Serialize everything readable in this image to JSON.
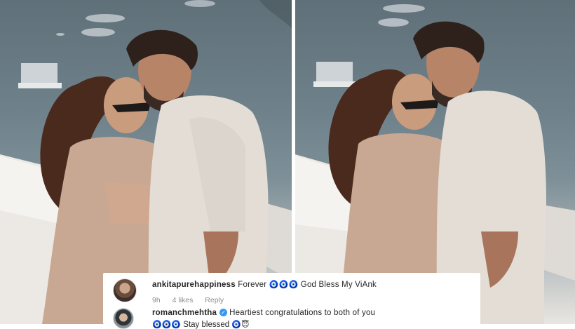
{
  "comments": [
    {
      "username": "ankitapurehappiness",
      "text_before": "Forever",
      "emoji_1": "🧿🧿🧿",
      "text_after": "God Bless My ViAnk",
      "time": "9h",
      "likes": "4 likes",
      "reply": "Reply"
    },
    {
      "username": "romanchmehtha",
      "text": "Heartiest congratulations to both of you",
      "emoji_line": "🧿🧿🧿",
      "text_2": "Stay blessed",
      "emoji_end": "🧿😇"
    }
  ],
  "colors": {
    "verified_badge": "#3897f0",
    "meta_text": "#8e8e8e",
    "comment_text": "#262626"
  },
  "icons": {
    "verified": "verified-badge-icon"
  }
}
